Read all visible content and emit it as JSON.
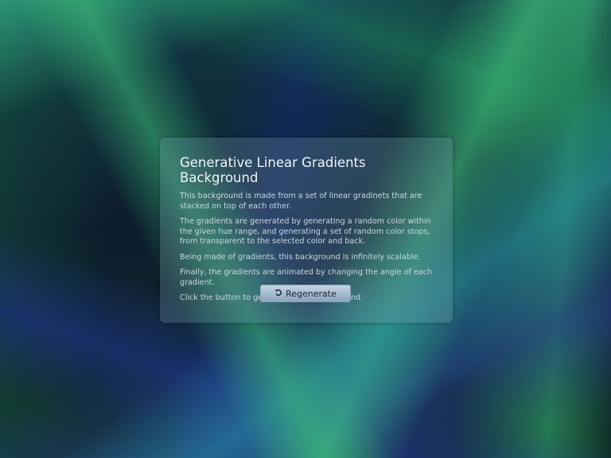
{
  "card": {
    "title": "Generative Linear Gradients Background",
    "paragraphs": [
      "This background is made from a set of linear gradinets that are stacked on top of each other.",
      "The gradients are generated by generating a random color within the given hue range, and generating a set of random color stops, from transparent to the selected color and back.",
      "Being made of gradients, this background is infinitely scalable.",
      "Finally, the gradients are animated by changing the angle of each gradient.",
      "Click the button to generate a new background."
    ],
    "button": {
      "label": "Regenerate",
      "icon": "refresh-icon"
    }
  }
}
